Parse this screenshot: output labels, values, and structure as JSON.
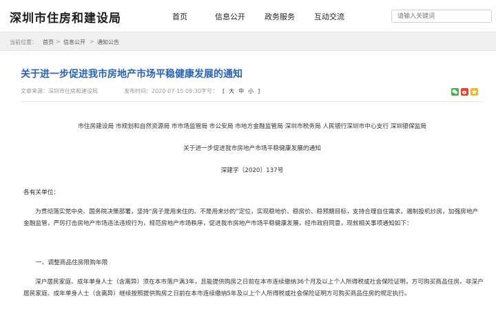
{
  "header": {
    "site_title": "深圳市住房和建设局",
    "nav": [
      "首页",
      "信息公开",
      "政务服务",
      "互动交流"
    ],
    "search_placeholder": "请输入关键词"
  },
  "breadcrumb": {
    "label": "当前位置：",
    "items": [
      "首页",
      "信息公开",
      "通知公告"
    ],
    "separator": ">"
  },
  "article": {
    "title": "关于进一步促进我市房地产市场平稳健康发展的通知",
    "meta": {
      "source": "文章来源：深圳市住房和建设局",
      "date": "发布时间：2020-07-15 09:30",
      "font_size_label": "字号：",
      "font_sizes": [
        "[",
        "大",
        "中",
        "小",
        "]"
      ]
    },
    "share_icons": [
      "wechat-icon",
      "weibo-icon",
      "qzone-icon"
    ],
    "issuers": "市住房建设局 市规划和自然资源局 市市场监管局 市公安局 市地方金融监管局 深圳市税务局 人民银行深圳市中心支行 深圳银保监局",
    "subtitle": "关于进一步促进我市房地产市场平稳健康发展的通知",
    "doc_no": "深建字〔2020〕137号",
    "salutation": "各有关单位：",
    "intro": "为贯彻落实党中央、国务院决策部署，坚持“房子是用来住的、不是用来炒的”定位，实现稳地价、稳房价、稳预期目标，支持合理自住需求，遏制投机炒房，加强房地产金融监管，严厉打击房地产市场违法违规行为，规范房地产市场秩序，促进我市房地产市场平稳健康发展，经市政府同意，现就相关事项通知如下：",
    "section1_title": "一、调整商品住房限购年限",
    "section1_body": "深户居民家庭、成年单身人士（含离异）须在本市落户满3年，且能提供购房之日前在本市连续缴纳36个月及以上个人所得税或社会保险证明，方可购买商品住房。非深户居民家庭、成年单身人士（含离异）继续按照提供购房之日前在本市连续缴纳5年及以上个人所得税或社会保险证明方可购买商品住房的规定执行。"
  },
  "colors": {
    "title_blue": "#2a63b8",
    "crumb_bg": "#f0f0f0",
    "wechat": "#3fb34f",
    "weibo": "#e2462f",
    "qzone": "#f1b523"
  }
}
